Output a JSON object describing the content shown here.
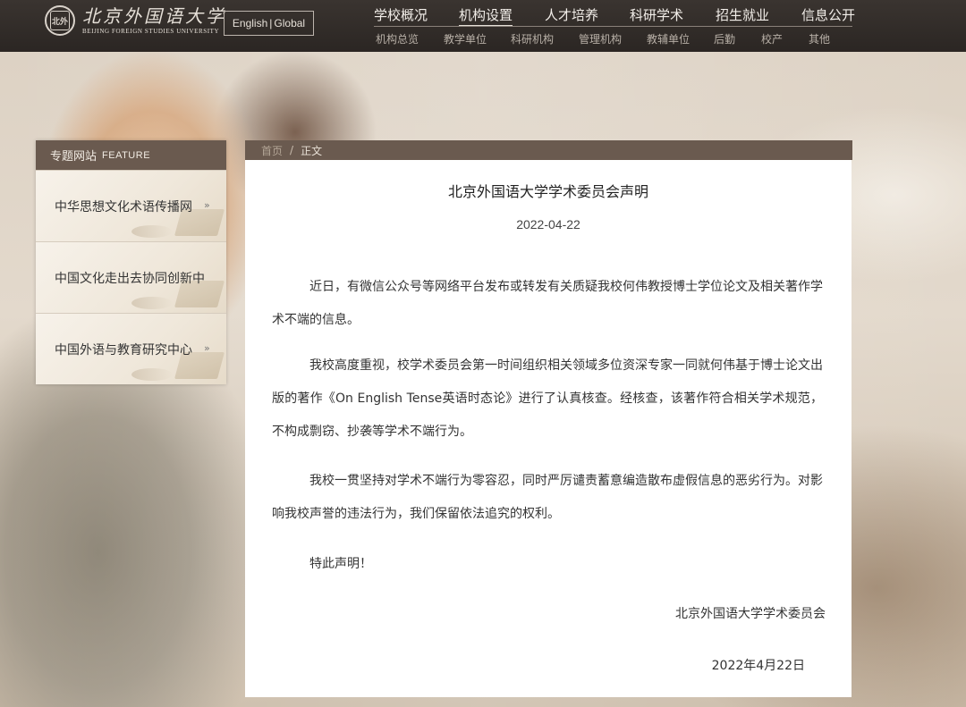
{
  "header": {
    "logo_seal": "北外",
    "logo_cn": "北京外国语大学",
    "logo_en": "BEIJING FOREIGN STUDIES UNIVERSITY",
    "lang_english": "English",
    "lang_global": "Global",
    "nav": [
      "学校概况",
      "机构设置",
      "人才培养",
      "科研学术",
      "招生就业",
      "信息公开"
    ],
    "active_nav": "机构设置",
    "subnav": [
      "机构总览",
      "教学单位",
      "科研机构",
      "管理机构",
      "教辅单位",
      "后勤",
      "校产",
      "其他"
    ]
  },
  "sidebar": {
    "title": "专题网站",
    "title_en": "FEATURE",
    "items": [
      {
        "label": "中华思想文化术语传播网"
      },
      {
        "label": "中国文化走出去协同创新中"
      },
      {
        "label": "中国外语与教育研究中心"
      }
    ],
    "arrow": "»"
  },
  "breadcrumb": {
    "home": "首页",
    "separator": "/",
    "current": "正文"
  },
  "article": {
    "title": "北京外国语大学学术委员会声明",
    "date": "2022-04-22",
    "paragraphs": [
      "近日，有微信公众号等网络平台发布或转发有关质疑我校何伟教授博士学位论文及相关著作学术不端的信息。",
      "我校高度重视，校学术委员会第一时间组织相关领域多位资深专家一同就何伟基于博士论文出版的著作《On English Tense英语时态论》进行了认真核查。经核查，该著作符合相关学术规范，不构成剽窃、抄袭等学术不端行为。",
      "我校一贯坚持对学术不端行为零容忍，同时严厉谴责蓄意编造散布虚假信息的恶劣行为。对影响我校声誉的违法行为，我们保留依法追究的权利。",
      "特此声明！"
    ],
    "signature": "北京外国语大学学术委员会",
    "sign_date": "2022年4月22日"
  }
}
